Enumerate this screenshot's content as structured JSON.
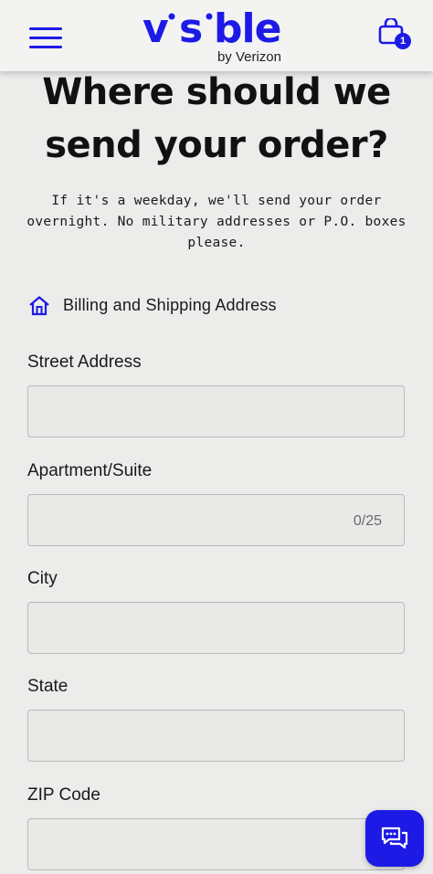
{
  "header": {
    "menu_icon": "hamburger-menu-icon",
    "logo_word": "visible",
    "logo_sub": "by Verizon",
    "cart_icon": "shopping-bag-icon",
    "cart_count": "1"
  },
  "page": {
    "title": "Where should we send your order?",
    "subtitle": "If it's a weekday, we'll send your order overnight. No military addresses or P.O. boxes please."
  },
  "section": {
    "icon": "home-icon",
    "label": "Billing and Shipping Address"
  },
  "form": {
    "street_label": "Street Address",
    "street_value": "",
    "apt_label": "Apartment/Suite",
    "apt_value": "",
    "apt_counter": "0/25",
    "city_label": "City",
    "city_value": "",
    "state_label": "State",
    "state_value": "",
    "zip_label": "ZIP Code",
    "zip_value": ""
  },
  "chat": {
    "icon": "chat-bubbles-icon"
  },
  "colors": {
    "brand": "#1d1ae6",
    "background": "#ececeb",
    "text": "#1a1a1a"
  }
}
